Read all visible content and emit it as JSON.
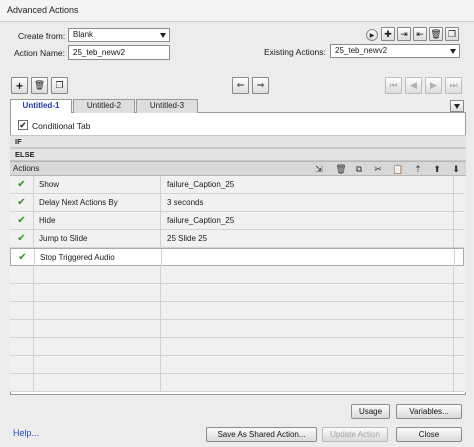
{
  "window": {
    "title": "Advanced Actions"
  },
  "form": {
    "create_from_label": "Create from:",
    "create_from_value": "Blank",
    "action_name_label": "Action Name:",
    "action_name_value": "25_teb_newv2",
    "existing_actions_label": "Existing Actions:",
    "existing_actions_value": "25_teb_newv2"
  },
  "tabs": [
    {
      "label": "Untitled-1",
      "active": true
    },
    {
      "label": "Untitled-2",
      "active": false
    },
    {
      "label": "Untitled-3",
      "active": false
    }
  ],
  "conditional": {
    "label": "Conditional Tab",
    "checked": true
  },
  "sections": {
    "if_label": "IF",
    "else_label": "ELSE",
    "actions_label": "Actions"
  },
  "icons": {
    "check": "✔",
    "plus": "+",
    "minus": "−"
  },
  "rows": [
    {
      "status": "check",
      "action": "Show",
      "target": "failure_Caption_25"
    },
    {
      "status": "check",
      "action": "Delay Next Actions By",
      "target": "3    seconds"
    },
    {
      "status": "check",
      "action": "Hide",
      "target": "failure_Caption_25"
    },
    {
      "status": "check",
      "action": "Jump to Slide",
      "target": "25 Slide 25"
    },
    {
      "status": "check",
      "action": "Stop Triggered Audio",
      "target": ""
    },
    {
      "status": "",
      "action": "",
      "target": ""
    },
    {
      "status": "",
      "action": "",
      "target": ""
    },
    {
      "status": "",
      "action": "",
      "target": ""
    },
    {
      "status": "",
      "action": "",
      "target": ""
    },
    {
      "status": "",
      "action": "",
      "target": ""
    },
    {
      "status": "",
      "action": "",
      "target": ""
    },
    {
      "status": "",
      "action": "",
      "target": ""
    }
  ],
  "buttons": {
    "usage": "Usage",
    "variables": "Variables...",
    "save_shared": "Save As Shared Action...",
    "update": "Update Action",
    "close": "Close",
    "help": "Help..."
  }
}
